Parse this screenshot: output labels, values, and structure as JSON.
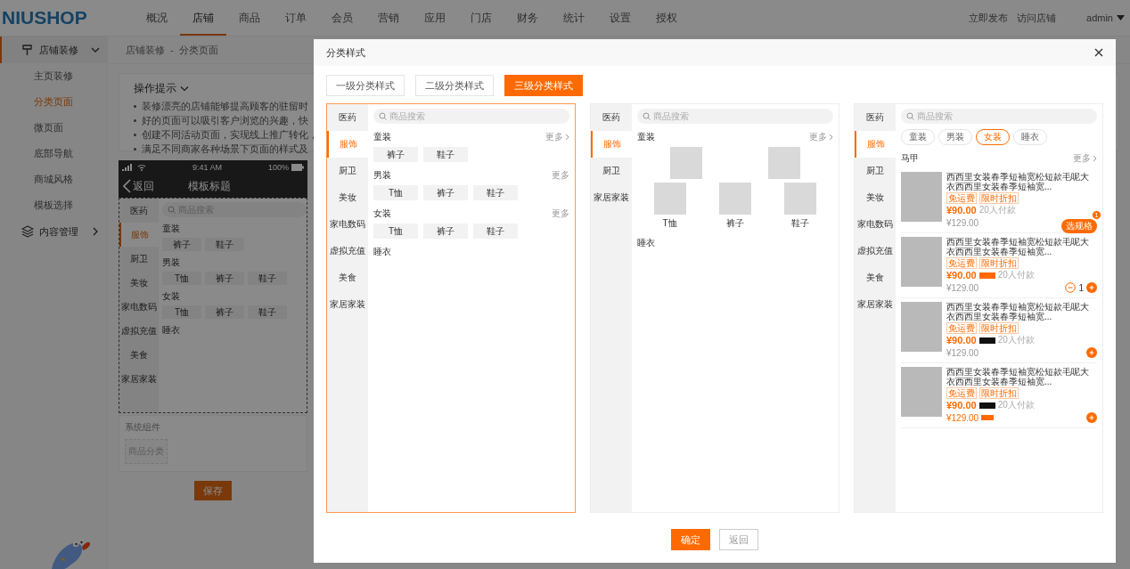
{
  "top_nav": {
    "logo": "NIUSHOP",
    "items": [
      {
        "label": "概况",
        "selected": false
      },
      {
        "label": "店铺",
        "selected": true
      },
      {
        "label": "商品",
        "selected": false
      },
      {
        "label": "订单",
        "selected": false
      },
      {
        "label": "会员",
        "selected": false
      },
      {
        "label": "营销",
        "selected": false
      },
      {
        "label": "应用",
        "selected": false
      },
      {
        "label": "门店",
        "selected": false
      },
      {
        "label": "财务",
        "selected": false
      },
      {
        "label": "统计",
        "selected": false
      },
      {
        "label": "设置",
        "selected": false
      },
      {
        "label": "授权",
        "selected": false
      }
    ],
    "links": [
      "立即发布",
      "访问店铺"
    ],
    "user": "admin"
  },
  "sidebar": [
    {
      "label": "店铺装修",
      "expanded": true,
      "children": [
        {
          "label": "主页装修",
          "selected": false
        },
        {
          "label": "分类页面",
          "selected": true
        },
        {
          "label": "微页面",
          "selected": false
        },
        {
          "label": "底部导航",
          "selected": false
        },
        {
          "label": "商城风格",
          "selected": false
        },
        {
          "label": "模板选择",
          "selected": false
        }
      ]
    },
    {
      "label": "内容管理",
      "expanded": false
    }
  ],
  "breadcrumb": {
    "items": [
      "店铺装修",
      "分类页面"
    ],
    "separator": "-"
  },
  "tips": {
    "title": "操作提示",
    "items": [
      "装修漂亮的店铺能够提高顾客的驻留时",
      "好的页面可以吸引客户浏览的兴趣，快",
      "创建不同活动页面，实现线上推广转化，",
      "满足不同商家各种场景下页面的样式及"
    ]
  },
  "phone_preview": {
    "time": "9:41 AM",
    "battery": "100%",
    "back": "返回",
    "title": "模板标题",
    "search_placeholder": "商品搜索",
    "categories": [
      {
        "label": "医药",
        "selected": false
      },
      {
        "label": "服饰",
        "selected": true
      },
      {
        "label": "厨卫",
        "selected": false
      },
      {
        "label": "美妆",
        "selected": false
      },
      {
        "label": "家电数码",
        "selected": false
      },
      {
        "label": "虚拟充值",
        "selected": false
      },
      {
        "label": "美食",
        "selected": false
      },
      {
        "label": "家居家装",
        "selected": false
      }
    ],
    "sections": [
      {
        "title": "童装",
        "chips": [
          "裤子",
          "鞋子"
        ]
      },
      {
        "title": "男装",
        "chips": [
          "T恤",
          "裤子",
          "鞋子"
        ]
      },
      {
        "title": "女装",
        "chips": [
          "T恤",
          "裤子",
          "鞋子"
        ]
      },
      {
        "title": "睡衣"
      }
    ]
  },
  "components": {
    "title": "系统组件",
    "items": [
      "商品分类"
    ]
  },
  "save_button": "保存",
  "dialog": {
    "title": "分类样式",
    "tabs": [
      {
        "label": "一级分类样式",
        "selected": false
      },
      {
        "label": "二级分类样式",
        "selected": false
      },
      {
        "label": "三级分类样式",
        "selected": true
      }
    ],
    "cards": [
      {
        "kind": "chips",
        "selected": true,
        "search_placeholder": "商品搜索",
        "categories": [
          {
            "label": "医药",
            "selected": false
          },
          {
            "label": "服饰",
            "selected": true
          },
          {
            "label": "厨卫",
            "selected": false
          },
          {
            "label": "美妆",
            "selected": false
          },
          {
            "label": "家电数码",
            "selected": false
          },
          {
            "label": "虚拟充值",
            "selected": false
          },
          {
            "label": "美食",
            "selected": false
          },
          {
            "label": "家居家装",
            "selected": false
          }
        ],
        "sections": [
          {
            "title": "童装",
            "more": "更多",
            "arrow": true,
            "chips": [
              "裤子",
              "鞋子"
            ]
          },
          {
            "title": "男装",
            "more": "更多",
            "arrow": false,
            "chips": [
              "T恤",
              "裤子",
              "鞋子"
            ]
          },
          {
            "title": "女装",
            "more": "更多",
            "arrow": false,
            "chips": [
              "T恤",
              "裤子",
              "鞋子"
            ]
          },
          {
            "title": "睡衣"
          }
        ]
      },
      {
        "kind": "images",
        "selected": false,
        "search_placeholder": "商品搜索",
        "categories": [
          {
            "label": "医药",
            "selected": false
          },
          {
            "label": "服饰",
            "selected": true
          },
          {
            "label": "厨卫",
            "selected": false
          },
          {
            "label": "家居家装",
            "selected": false
          }
        ],
        "sections": [
          {
            "title": "童装",
            "more": "更多",
            "arrow": true,
            "items": [
              {
                "kind": "photo"
              },
              {
                "kind": "photo"
              }
            ]
          },
          {
            "items": [
              {
                "kind": "photo",
                "label": "T恤"
              },
              {
                "kind": "photo",
                "label": "裤子"
              },
              {
                "kind": "photo",
                "label": "鞋子"
              }
            ]
          },
          {
            "title": "睡衣"
          }
        ]
      },
      {
        "kind": "products",
        "selected": false,
        "search_placeholder": "商品搜索",
        "categories": [
          {
            "label": "医药",
            "selected": false
          },
          {
            "label": "服饰",
            "selected": true
          },
          {
            "label": "厨卫",
            "selected": false
          },
          {
            "label": "美妆",
            "selected": false
          },
          {
            "label": "家电数码",
            "selected": false
          },
          {
            "label": "虚拟充值",
            "selected": false
          },
          {
            "label": "美食",
            "selected": false
          },
          {
            "label": "家居家装",
            "selected": false
          }
        ],
        "chips": [
          {
            "label": "童装",
            "selected": false
          },
          {
            "label": "男装",
            "selected": false
          },
          {
            "label": "女装",
            "selected": true
          },
          {
            "label": "睡衣",
            "selected": false
          }
        ],
        "section_title": "马甲",
        "more": "更多",
        "products": [
          {
            "title": "西西里女装春季短袖宽松短款毛呢大衣西西里女装春季短袖宽...",
            "tags": [
              "免运费",
              "限时折扣"
            ],
            "price": "¥90.00",
            "sales": "20人付款",
            "old_price": "¥129.00",
            "old_price_promo": false,
            "kind": "spec",
            "action_label": "选规格",
            "action_count": "1"
          },
          {
            "title": "西西里女装春季短袖宽松短款毛呢大衣西西里女装春季短袖宽...",
            "tags": [
              "免运费",
              "限时折扣"
            ],
            "price": "¥90.00",
            "price_badge": {
              "color": "#ff6a00"
            },
            "sales": "20人付款",
            "old_price": "¥129.00",
            "old_price_promo": false,
            "kind": "stepper",
            "quantity": "1"
          },
          {
            "title": "西西里女装春季短袖宽松短款毛呢大衣西西里女装春季短袖宽...",
            "tags": [
              "免运费",
              "限时折扣"
            ],
            "price": "¥90.00",
            "price_badge": {
              "color": "#111111"
            },
            "sales": "20人付款",
            "old_price": "¥129.00",
            "old_price_promo": false,
            "kind": "add"
          },
          {
            "title": "西西里女装春季短袖宽松短款毛呢大衣西西里女装春季短袖宽...",
            "tags": [
              "免运费",
              "限时折扣"
            ],
            "price": "¥90.00",
            "price_badge": {
              "color": "#111111"
            },
            "sales": "20人付款",
            "old_price": "¥129.00",
            "old_price_promo": true,
            "kind": "add"
          }
        ]
      }
    ],
    "buttons": [
      {
        "label": "确定",
        "kind": "primary"
      },
      {
        "label": "返回",
        "kind": "default"
      }
    ]
  }
}
